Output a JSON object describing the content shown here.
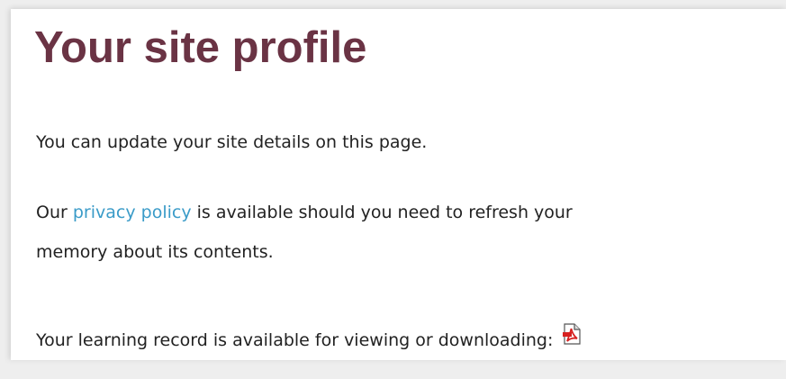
{
  "page": {
    "title": "Your site profile"
  },
  "intro": {
    "text": "You can update your site details on this page."
  },
  "privacy": {
    "prefix": "Our ",
    "link_label": "privacy policy",
    "line1_suffix": " is available should you need to refresh your",
    "line2": "memory about its contents."
  },
  "learning_record": {
    "text": "Your learning record is available for viewing or downloading:",
    "icon": "pdf-icon"
  },
  "colors": {
    "title": "#6a3344",
    "link": "#3a9bc8",
    "body_text": "#222222",
    "pdf_red": "#d6201f"
  }
}
